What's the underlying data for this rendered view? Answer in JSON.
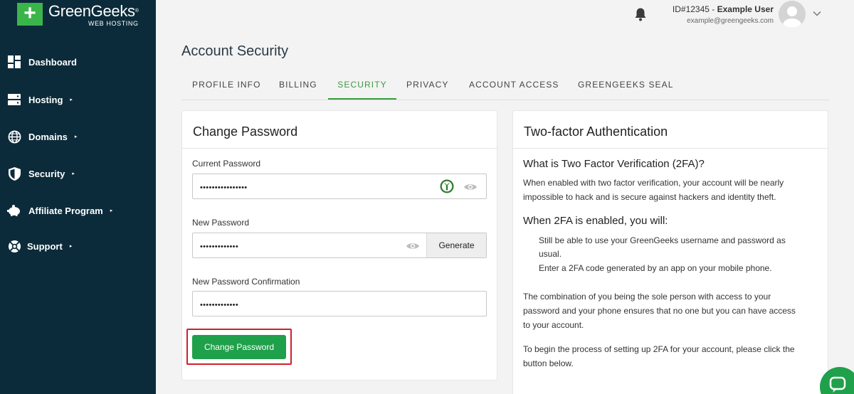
{
  "brand": {
    "name": "GreenGeeks",
    "reg": "®",
    "subtitle": "WEB HOSTING"
  },
  "sidebar": {
    "items": [
      {
        "label": "Dashboard",
        "icon": "dashboard-icon",
        "has_arrow": false
      },
      {
        "label": "Hosting",
        "icon": "server-icon",
        "has_arrow": true
      },
      {
        "label": "Domains",
        "icon": "globe-icon",
        "has_arrow": true
      },
      {
        "label": "Security",
        "icon": "shield-icon",
        "has_arrow": true
      },
      {
        "label": "Affiliate Program",
        "icon": "piggy-bank-icon",
        "has_arrow": true
      },
      {
        "label": "Support",
        "icon": "lifebuoy-icon",
        "has_arrow": true
      }
    ],
    "arrow": "▸"
  },
  "header": {
    "user_id": "ID#12345 - ",
    "user_name": "Example User",
    "email": "example@greengeeks.com"
  },
  "page": {
    "title": "Account Security"
  },
  "tabs": [
    {
      "label": "PROFILE INFO",
      "active": false
    },
    {
      "label": "BILLING",
      "active": false
    },
    {
      "label": "SECURITY",
      "active": true
    },
    {
      "label": "PRIVACY",
      "active": false
    },
    {
      "label": "ACCOUNT ACCESS",
      "active": false
    },
    {
      "label": "GREENGEEKS SEAL",
      "active": false
    }
  ],
  "change_password": {
    "title": "Change Password",
    "current_label": "Current Password",
    "current_value": "••••••••••••••••",
    "new_label": "New Password",
    "new_value": "•••••••••••••",
    "generate_label": "Generate",
    "confirm_label": "New Password Confirmation",
    "confirm_value": "•••••••••••••",
    "submit_label": "Change Password"
  },
  "two_factor": {
    "title": "Two-factor Authentication",
    "what_heading": "What is Two Factor Verification (2FA)?",
    "what_line1": "When enabled with two factor verification, your account will be nearly",
    "what_line2": "impossible to hack and is secure against hackers and identity theft.",
    "when_heading": "When 2FA is enabled, you will:",
    "bullet1_line1": "Still be able to use your GreenGeeks username and password as",
    "bullet1_line2": "usual.",
    "bullet2": "Enter a 2FA code generated by an app on your mobile phone.",
    "combo_line1": "The combination of you being the sole person with access to your",
    "combo_line2": "password and your phone ensures that no one but you can have access",
    "combo_line3": "to your account.",
    "begin_line1": "To begin the process of setting up 2FA for your account, please click the",
    "begin_line2": "button below."
  },
  "colors": {
    "sidebar_bg": "#0c2b3a",
    "accent": "#3a9b3c",
    "button": "#1fa04a",
    "highlight": "#d0202a"
  }
}
